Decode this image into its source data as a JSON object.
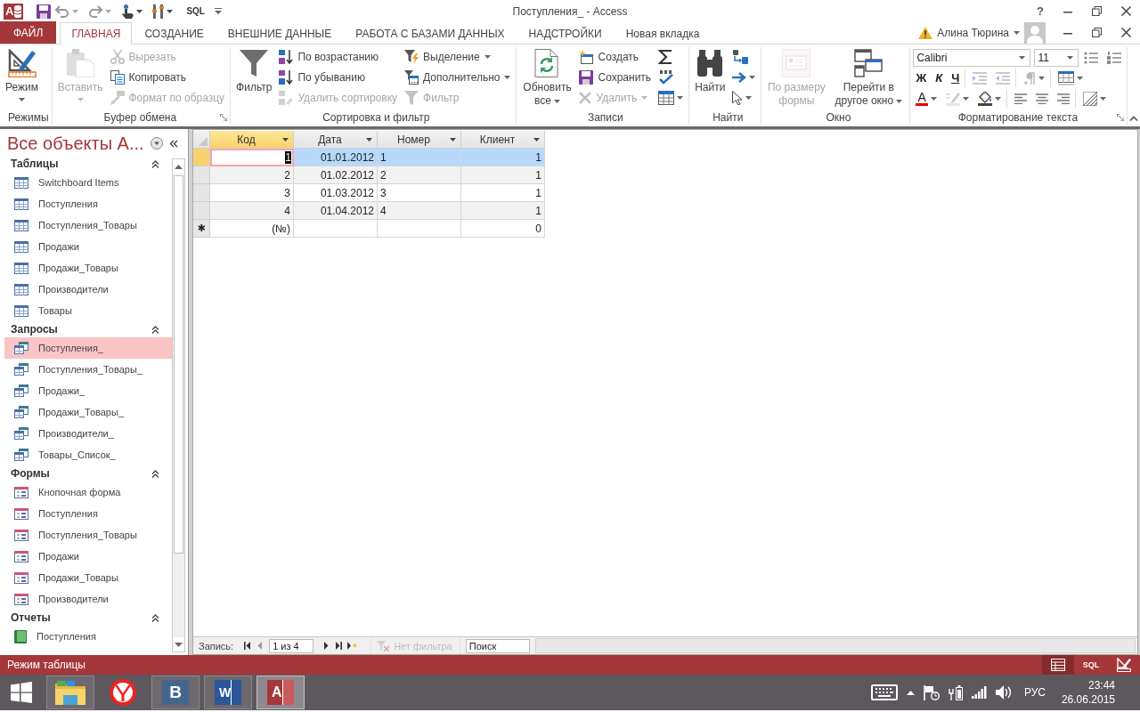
{
  "window": {
    "logo": "A",
    "title": "Поступления_ - Access",
    "help": "?"
  },
  "quick_access": {
    "sql": "SQL"
  },
  "ribbon": {
    "tabs": [
      {
        "label": "ФАЙЛ",
        "kind": "file",
        "selected": false
      },
      {
        "label": "ГЛАВНАЯ",
        "kind": "tab",
        "selected": true
      },
      {
        "label": "СОЗДАНИЕ",
        "kind": "tab",
        "selected": false
      },
      {
        "label": "ВНЕШНИЕ ДАННЫЕ",
        "kind": "tab",
        "selected": false
      },
      {
        "label": "РАБОТА С БАЗАМИ ДАННЫХ",
        "kind": "tab",
        "selected": false
      },
      {
        "label": "НАДСТРОЙКИ",
        "kind": "tab",
        "selected": false
      },
      {
        "label": "Новая вкладка",
        "kind": "tab",
        "selected": false
      }
    ],
    "account": {
      "user": "Алина Тюрина",
      "warning": true
    },
    "groups": [
      {
        "title": "Режимы",
        "launcher": false,
        "columns": [
          [
            {
              "kind": "large",
              "label": "Режим",
              "disabled": false,
              "dropdown": true
            }
          ]
        ]
      },
      {
        "title": "Буфер обмена",
        "launcher": true,
        "columns": [
          [
            {
              "kind": "large",
              "label": "Вставить",
              "disabled": true,
              "dropdown": true
            }
          ],
          [
            {
              "kind": "small",
              "label": "Вырезать",
              "disabled": true,
              "dropdown": false
            },
            {
              "kind": "small",
              "label": "Копировать",
              "disabled": false,
              "dropdown": false
            },
            {
              "kind": "small",
              "label": "Формат по образцу",
              "disabled": true,
              "dropdown": false
            }
          ]
        ]
      },
      {
        "title": "Сортировка и фильтр",
        "launcher": false,
        "columns": [
          [
            {
              "kind": "large",
              "label": "Фильтр",
              "disabled": false,
              "dropdown": false
            }
          ],
          [
            {
              "kind": "small",
              "label": "По возрастанию",
              "disabled": false,
              "dropdown": false
            },
            {
              "kind": "small",
              "label": "По убыванию",
              "disabled": false,
              "dropdown": false
            },
            {
              "kind": "small",
              "label": "Удалить сортировку",
              "disabled": true,
              "dropdown": false
            }
          ],
          [
            {
              "kind": "small",
              "label": "Выделение",
              "disabled": false,
              "dropdown": true
            },
            {
              "kind": "small",
              "label": "Дополнительно",
              "disabled": false,
              "dropdown": true
            },
            {
              "kind": "small",
              "label": "Фильтр",
              "disabled": true,
              "dropdown": false
            }
          ]
        ]
      },
      {
        "title": "Записи",
        "launcher": false,
        "columns": [
          [
            {
              "kind": "large",
              "label": "Обновить все",
              "disabled": false,
              "dropdown": true
            }
          ],
          [
            {
              "kind": "small",
              "label": "Создать",
              "disabled": false,
              "dropdown": false
            },
            {
              "kind": "small",
              "label": "Сохранить",
              "disabled": false,
              "dropdown": false
            },
            {
              "kind": "small",
              "label": "Удалить",
              "disabled": true,
              "dropdown": true
            }
          ],
          [
            {
              "kind": "icon",
              "disabled": false,
              "dropdown": false
            },
            {
              "kind": "icon",
              "disabled": false,
              "dropdown": false
            },
            {
              "kind": "icon",
              "disabled": false,
              "dropdown": true
            }
          ]
        ]
      },
      {
        "title": "Найти",
        "launcher": false,
        "columns": [
          [
            {
              "kind": "large",
              "label": "Найти",
              "disabled": false,
              "dropdown": false
            }
          ],
          [
            {
              "kind": "icon",
              "disabled": false,
              "dropdown": false
            },
            {
              "kind": "icon",
              "disabled": false,
              "dropdown": true
            },
            {
              "kind": "icon",
              "disabled": false,
              "dropdown": true
            }
          ]
        ]
      },
      {
        "title": "Окно",
        "launcher": false,
        "columns": [
          [
            {
              "kind": "large",
              "label": "По размеру формы",
              "disabled": true,
              "dropdown": false
            }
          ],
          [
            {
              "kind": "large",
              "label": "Перейти в другое окно",
              "disabled": false,
              "dropdown": true
            }
          ]
        ]
      },
      {
        "title": "Форматирование текста",
        "launcher": true,
        "rows": [
          [
            [
              {
                "kind": "combo",
                "value": "Calibri"
              },
              {
                "kind": "combo",
                "value": "11"
              }
            ],
            [
              {
                "kind": "icon",
                "disabled": false,
                "dropdown": false
              },
              {
                "kind": "icon",
                "disabled": false,
                "dropdown": false
              }
            ]
          ],
          [
            [
              {
                "kind": "glyph",
                "label": "Ж",
                "disabled": false,
                "dropdown": false
              },
              {
                "kind": "glyph",
                "label": "К",
                "disabled": false,
                "dropdown": false
              },
              {
                "kind": "glyph",
                "label": "Ч",
                "disabled": false,
                "dropdown": false
              }
            ],
            [
              {
                "kind": "icon",
                "disabled": true,
                "dropdown": false
              },
              {
                "kind": "icon",
                "disabled": true,
                "dropdown": false
              }
            ],
            [
              {
                "kind": "icon",
                "disabled": true,
                "dropdown": true
              }
            ],
            [
              {
                "kind": "icon",
                "disabled": false,
                "dropdown": true
              }
            ]
          ],
          [
            [
              {
                "kind": "glyph",
                "label": "A",
                "disabled": false,
                "dropdown": true
              },
              {
                "kind": "icon",
                "disabled": true,
                "dropdown": true
              },
              {
                "kind": "icon",
                "disabled": false,
                "dropdown": true
              }
            ],
            [
              {
                "kind": "icon",
                "disabled": false,
                "dropdown": false
              },
              {
                "kind": "icon",
                "disabled": false,
                "dropdown": false
              },
              {
                "kind": "icon",
                "disabled": false,
                "dropdown": false
              }
            ],
            [
              {
                "kind": "icon",
                "disabled": false,
                "dropdown": true
              }
            ]
          ]
        ]
      }
    ]
  },
  "navigation": {
    "title": "Все объекты A...",
    "groups": [
      {
        "title": "Таблицы",
        "kind": "table",
        "expanded": true,
        "items": [
          {
            "label": "Switchboard Items",
            "selected": false
          },
          {
            "label": "Поступления",
            "selected": false
          },
          {
            "label": "Поступления_Товары",
            "selected": false
          },
          {
            "label": "Продажи",
            "selected": false
          },
          {
            "label": "Продажи_Товары",
            "selected": false
          },
          {
            "label": "Производители",
            "selected": false
          },
          {
            "label": "Товары",
            "selected": false
          }
        ]
      },
      {
        "title": "Запросы",
        "kind": "query",
        "expanded": true,
        "items": [
          {
            "label": "Поступления_",
            "selected": true
          },
          {
            "label": "Поступления_Товары_",
            "selected": false
          },
          {
            "label": "Продажи_",
            "selected": false
          },
          {
            "label": "Продажи_Товары_",
            "selected": false
          },
          {
            "label": "Производители_",
            "selected": false
          },
          {
            "label": "Товары_Список_",
            "selected": false
          }
        ]
      },
      {
        "title": "Формы",
        "kind": "form",
        "expanded": true,
        "items": [
          {
            "label": "Кнопочная форма",
            "selected": false
          },
          {
            "label": "Поступления",
            "selected": false
          },
          {
            "label": "Поступления_Товары",
            "selected": false
          },
          {
            "label": "Продажи",
            "selected": false
          },
          {
            "label": "Продажи_Товары",
            "selected": false
          },
          {
            "label": "Производители",
            "selected": false
          }
        ]
      },
      {
        "title": "Отчеты",
        "kind": "report",
        "expanded": true,
        "items": [
          {
            "label": "Поступления",
            "selected": false
          }
        ]
      }
    ]
  },
  "datasheet": {
    "columns": [
      {
        "label": "Код",
        "numeric": true,
        "selected": true
      },
      {
        "label": "Дата",
        "numeric": true,
        "selected": false
      },
      {
        "label": "Номер",
        "numeric": false,
        "selected": false
      },
      {
        "label": "Клиент",
        "numeric": true,
        "selected": false
      }
    ],
    "rows": [
      {
        "cells": [
          "1",
          "01.01.2012",
          "1",
          "1"
        ],
        "selected": true
      },
      {
        "cells": [
          "2",
          "01.02.2012",
          "2",
          "1"
        ],
        "selected": false
      },
      {
        "cells": [
          "3",
          "01.03.2012",
          "3",
          "1"
        ],
        "selected": false
      },
      {
        "cells": [
          "4",
          "01.04.2012",
          "4",
          "1"
        ],
        "selected": false
      }
    ],
    "new_row": {
      "marker": "✱",
      "cells": [
        "(№)",
        null,
        null,
        "0"
      ]
    },
    "record_nav": {
      "label": "Запись:",
      "buttons": [
        {
          "kind": "first",
          "disabled": false
        },
        {
          "kind": "previous",
          "disabled": true
        },
        {
          "kind": "next",
          "disabled": false
        },
        {
          "kind": "last",
          "disabled": false
        },
        {
          "kind": "new",
          "disabled": false
        }
      ],
      "current": "1 из 4",
      "filter": {
        "label": "Нет фильтра",
        "disabled": true
      },
      "search": {
        "placeholder": "Поиск"
      }
    }
  },
  "status_bar": {
    "mode": "Режим таблицы",
    "views": [
      {
        "kind": "datasheet",
        "selected": true
      },
      {
        "kind": "sql",
        "label": "SQL",
        "selected": false
      },
      {
        "kind": "design",
        "selected": false
      }
    ]
  },
  "taskbar": {
    "apps": [
      {
        "kind": "explorer",
        "running": true,
        "selected": false
      },
      {
        "kind": "browser",
        "running": false,
        "selected": false
      },
      {
        "kind": "vk",
        "glyph": "В",
        "running": true,
        "selected": false
      },
      {
        "kind": "word",
        "glyph": "W",
        "running": true,
        "selected": false
      },
      {
        "kind": "access",
        "glyph": "A",
        "running": true,
        "selected": true
      }
    ],
    "tray": {
      "language": "РУС",
      "time": "23:44",
      "date": "26.06.2015"
    }
  }
}
